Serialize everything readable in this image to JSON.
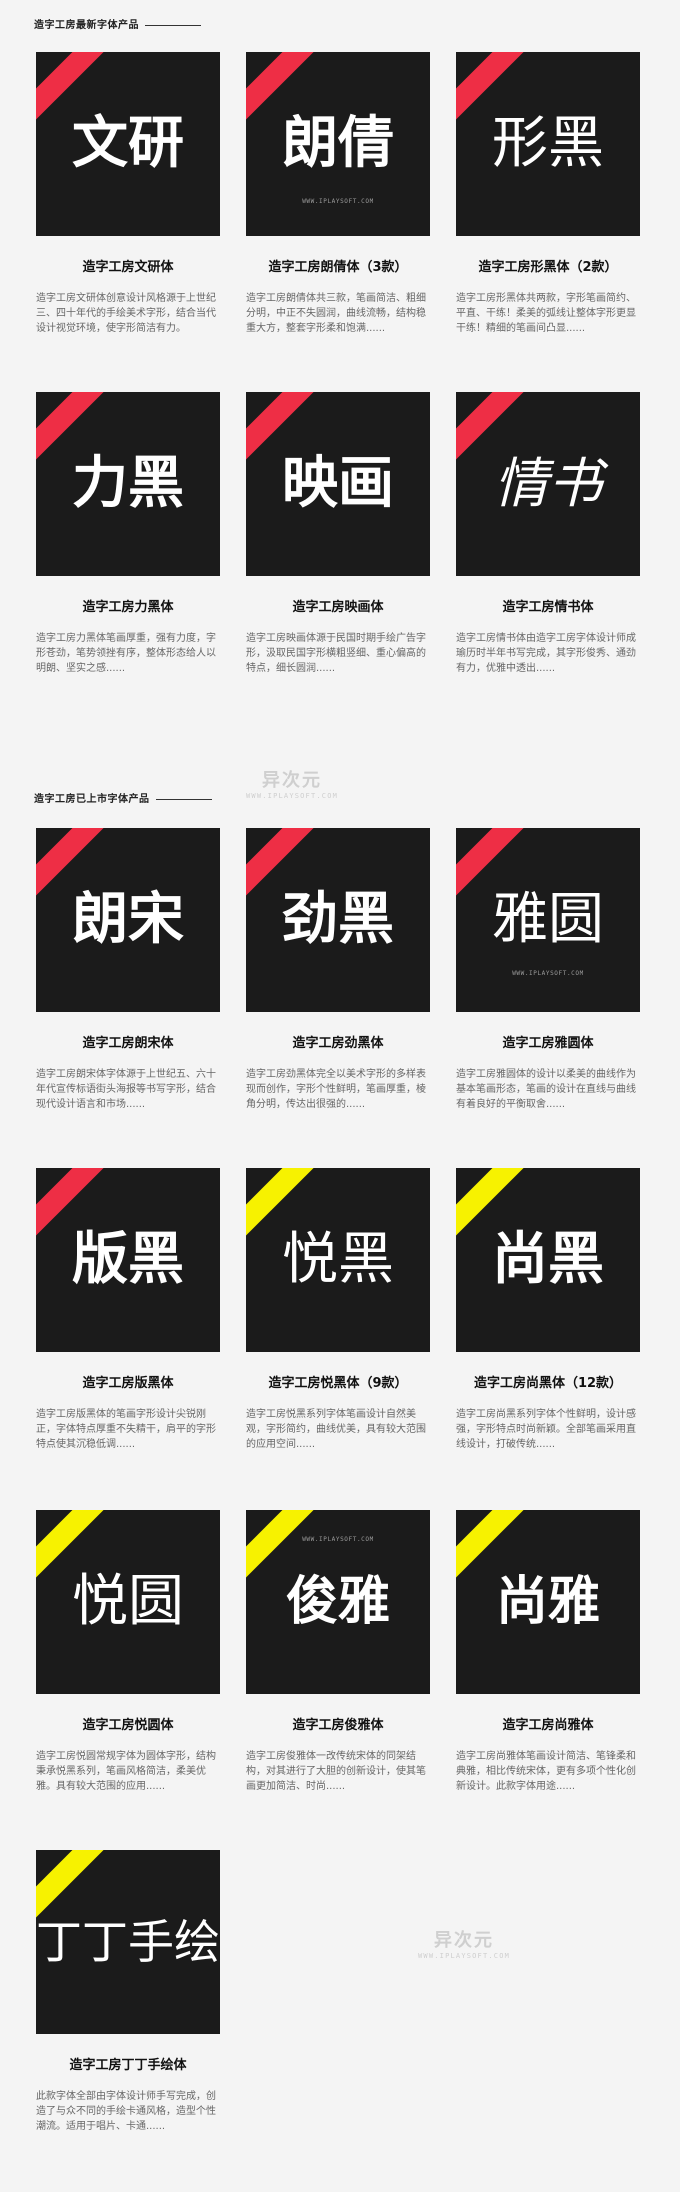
{
  "section1": {
    "title": "造字工房最新字体产品"
  },
  "section2": {
    "title": "造字工房已上市字体产品"
  },
  "watermark": {
    "cn": "异次元",
    "en": "WWW.IPLAYSOFT.COM"
  },
  "tile_watermark": "WWW.IPLAYSOFT.COM",
  "colors": {
    "tile_bg": "#1b1b1b",
    "ribbon_red": "#ee2e45",
    "ribbon_yellow": "#f7f200",
    "page_bg": "#f4f4f4"
  },
  "fonts": [
    {
      "glyphs": "文研",
      "name": "造字工房文研体",
      "desc": "造字工房文研体创意设计风格源于上世纪三、四十年代的手绘美术字形，结合当代设计视觉环境，使字形简洁有力。",
      "ribbon": "red"
    },
    {
      "glyphs": "朗倩",
      "name": "造字工房朗倩体（3款）",
      "desc": "造字工房朗倩体共三款，笔画简洁、粗细分明，中正不失圆润，曲线流畅，结构稳重大方，整套字形柔和饱满......",
      "ribbon": "red"
    },
    {
      "glyphs": "形黑",
      "name": "造字工房形黑体（2款）",
      "desc": "造字工房形黑体共两款，字形笔画简约、平直、干练！柔美的弧线让整体字形更显干练！精细的笔画间凸显......",
      "ribbon": "red"
    },
    {
      "glyphs": "力黑",
      "name": "造字工房力黑体",
      "desc": "造字工房力黑体笔画厚重，强有力度，字形苍劲，笔势领挫有序，整体形态给人以明朗、坚实之感......",
      "ribbon": "red"
    },
    {
      "glyphs": "映画",
      "name": "造字工房映画体",
      "desc": "造字工房映画体源于民国时期手绘广告字形，汲取民国字形横粗竖细、重心偏高的特点，细长圆润......",
      "ribbon": "red"
    },
    {
      "glyphs": "情书",
      "name": "造字工房情书体",
      "desc": "造字工房情书体由造字工房字体设计师成瑜历时半年书写完成，其字形俊秀、通劲有力，优雅中透出......",
      "ribbon": "red"
    },
    {
      "glyphs": "朗宋",
      "name": "造字工房朗宋体",
      "desc": "造字工房朗宋体字体源于上世纪五、六十年代宣传标语街头海报等书写字形，结合现代设计语言和市场......",
      "ribbon": "red"
    },
    {
      "glyphs": "劲黑",
      "name": "造字工房劲黑体",
      "desc": "造字工房劲黑体完全以美术字形的多样表现而创作，字形个性鲜明，笔画厚重，棱角分明，传达出很强的......",
      "ribbon": "red"
    },
    {
      "glyphs": "雅圆",
      "name": "造字工房雅圆体",
      "desc": "造字工房雅圆体的设计以柔美的曲线作为基本笔画形态，笔画的设计在直线与曲线有着良好的平衡取舍......",
      "ribbon": "red"
    },
    {
      "glyphs": "版黑",
      "name": "造字工房版黑体",
      "desc": "造字工房版黑体的笔画字形设计尖锐刚正，字体特点厚重不失精干，肩平的字形特点使其沉稳低调......",
      "ribbon": "red"
    },
    {
      "glyphs": "悦黑",
      "name": "造字工房悦黑体（9款）",
      "desc": "造字工房悦黑系列字体笔画设计自然美观，字形简约，曲线优美，具有较大范围的应用空间......",
      "ribbon": "yellow"
    },
    {
      "glyphs": "尚黑",
      "name": "造字工房尚黑体（12款）",
      "desc": "造字工房尚黑系列字体个性鲜明，设计感强，字形特点时尚新颖。全部笔画采用直线设计，打破传统......",
      "ribbon": "yellow"
    },
    {
      "glyphs": "悦圆",
      "name": "造字工房悦圆体",
      "desc": "造字工房悦圆常规字体为圆体字形，结构秉承悦黑系列，笔画风格简洁，柔美优雅。具有较大范围的应用......",
      "ribbon": "yellow"
    },
    {
      "glyphs": "俊雅",
      "name": "造字工房俊雅体",
      "desc": "造字工房俊雅体一改传统宋体的同架结构，对其进行了大胆的创新设计，使其笔画更加简洁、时尚......",
      "ribbon": "yellow"
    },
    {
      "glyphs": "尚雅",
      "name": "造字工房尚雅体",
      "desc": "造字工房尚雅体笔画设计简洁、笔锋柔和典雅，相比传统宋体，更有多项个性化创新设计。此款字体用途......",
      "ribbon": "yellow"
    },
    {
      "glyphs": "丁丁手绘",
      "name": "造字工房丁丁手绘体",
      "desc": "此款字体全部由字体设计师手写完成，创造了与众不同的手绘卡通风格，造型个性潮流。适用于唱片、卡通......",
      "ribbon": "yellow"
    }
  ]
}
